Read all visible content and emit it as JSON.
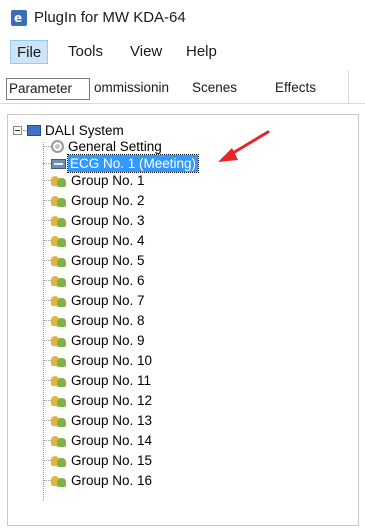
{
  "window": {
    "title": "PlugIn for MW KDA-64"
  },
  "menu": {
    "items": [
      {
        "label": "File"
      },
      {
        "label": "Tools"
      },
      {
        "label": "View"
      },
      {
        "label": "Help"
      }
    ]
  },
  "tabs": {
    "items": [
      {
        "label": "Parameter"
      },
      {
        "label": "ommissionin"
      },
      {
        "label": "Scenes"
      },
      {
        "label": "Effects"
      }
    ]
  },
  "tree": {
    "root": {
      "label": "DALI System",
      "icon": "dali-system-icon"
    },
    "children": [
      {
        "label": "General Setting",
        "icon": "gear-icon"
      },
      {
        "label": "ECG No. 1 (Meeting)",
        "icon": "ecg-icon"
      },
      {
        "label": "Group No. 1",
        "icon": "group-icon"
      },
      {
        "label": "Group No. 2",
        "icon": "group-icon"
      },
      {
        "label": "Group No. 3",
        "icon": "group-icon"
      },
      {
        "label": "Group No. 4",
        "icon": "group-icon"
      },
      {
        "label": "Group No. 5",
        "icon": "group-icon"
      },
      {
        "label": "Group No. 6",
        "icon": "group-icon"
      },
      {
        "label": "Group No. 7",
        "icon": "group-icon"
      },
      {
        "label": "Group No. 8",
        "icon": "group-icon"
      },
      {
        "label": "Group No. 9",
        "icon": "group-icon"
      },
      {
        "label": "Group No. 10",
        "icon": "group-icon"
      },
      {
        "label": "Group No. 11",
        "icon": "group-icon"
      },
      {
        "label": "Group No. 12",
        "icon": "group-icon"
      },
      {
        "label": "Group No. 13",
        "icon": "group-icon"
      },
      {
        "label": "Group No. 14",
        "icon": "group-icon"
      },
      {
        "label": "Group No. 15",
        "icon": "group-icon"
      },
      {
        "label": "Group No. 16",
        "icon": "group-icon"
      }
    ]
  },
  "colors": {
    "selection": "#3399ff",
    "menu_active": "#cce4f7",
    "annotation_arrow": "#e8242b"
  }
}
